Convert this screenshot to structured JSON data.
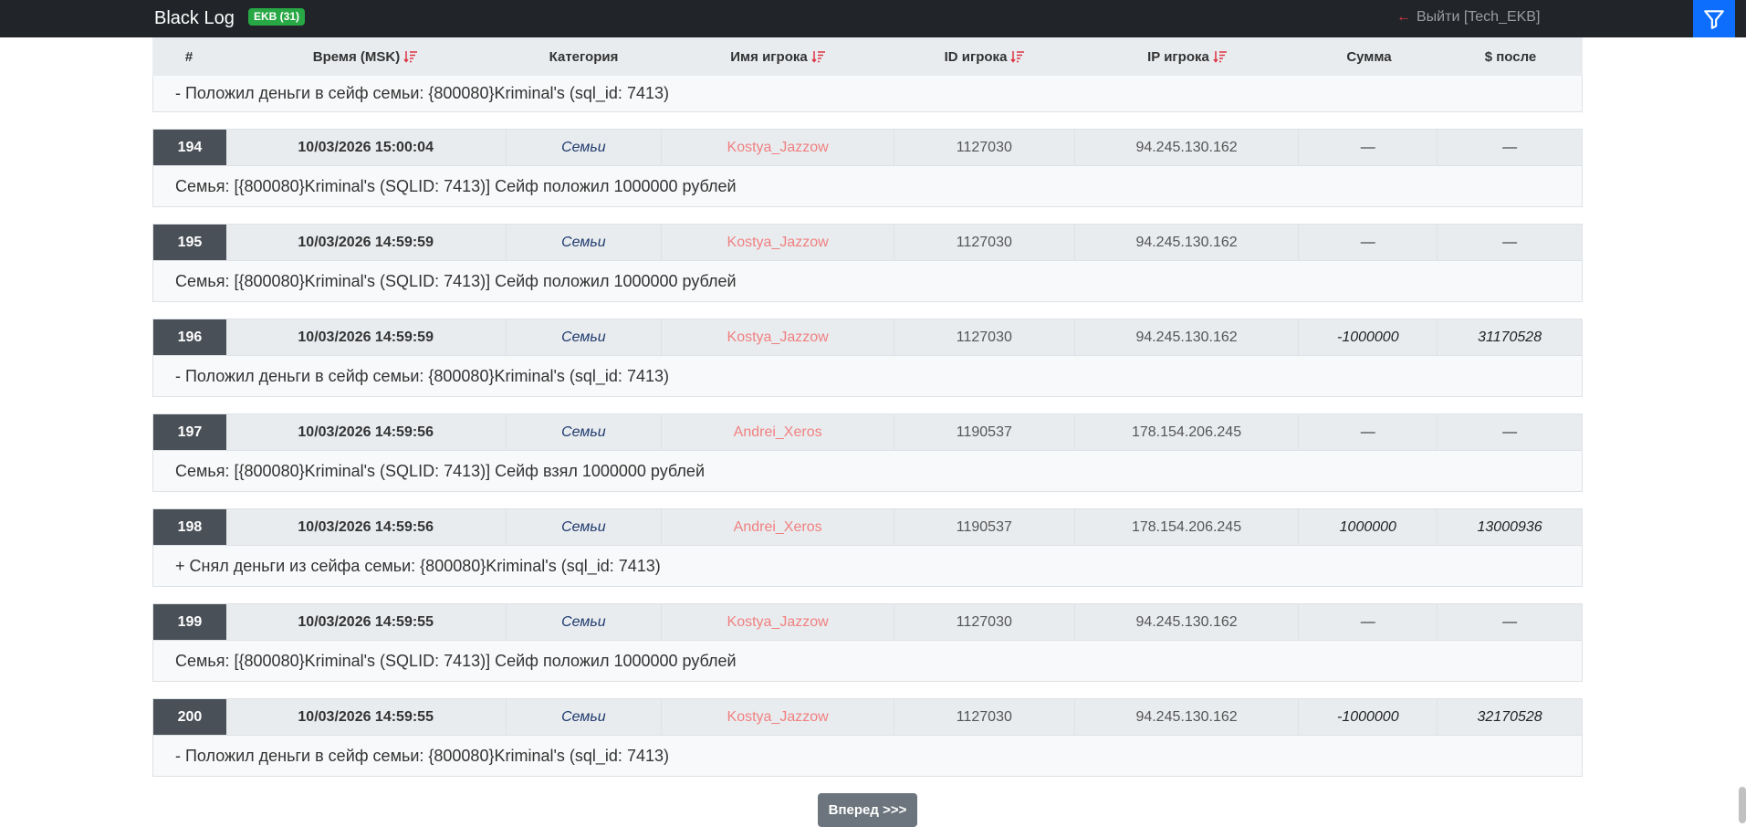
{
  "navbar": {
    "brand": "Black Log",
    "badge": "EKB (31)",
    "logout_arrow": "←",
    "logout_label": "Выйти [Tech_EKB]",
    "filter_icon": "funnel-icon",
    "accent": "#0d6efd"
  },
  "table": {
    "headers": [
      "#",
      "Время (MSK)",
      "Категория",
      "Имя игрока",
      "ID игрока",
      "IP игрока",
      "Сумма",
      "$ после"
    ],
    "first_message": "- Положил деньги в сейф семьи: {800080}Kriminal's (sql_id: 7413)",
    "entries": [
      {
        "num": "194",
        "time": "10/03/2026 15:00:04",
        "category": "Семьи",
        "player": "Kostya_Jazzow",
        "player_id": "1127030",
        "ip": "94.245.130.162",
        "amount": "—",
        "after": "—",
        "message": "Семья: [{800080}Kriminal's (SQLID: 7413)] Сейф положил 1000000 рублей"
      },
      {
        "num": "195",
        "time": "10/03/2026 14:59:59",
        "category": "Семьи",
        "player": "Kostya_Jazzow",
        "player_id": "1127030",
        "ip": "94.245.130.162",
        "amount": "—",
        "after": "—",
        "message": "Семья: [{800080}Kriminal's (SQLID: 7413)] Сейф положил 1000000 рублей"
      },
      {
        "num": "196",
        "time": "10/03/2026 14:59:59",
        "category": "Семьи",
        "player": "Kostya_Jazzow",
        "player_id": "1127030",
        "ip": "94.245.130.162",
        "amount": "-1000000",
        "after": "31170528",
        "message": "- Положил деньги в сейф семьи: {800080}Kriminal's (sql_id: 7413)"
      },
      {
        "num": "197",
        "time": "10/03/2026 14:59:56",
        "category": "Семьи",
        "player": "Andrei_Xeros",
        "player_id": "1190537",
        "ip": "178.154.206.245",
        "amount": "—",
        "after": "—",
        "message": "Семья: [{800080}Kriminal's (SQLID: 7413)] Сейф взял 1000000 рублей"
      },
      {
        "num": "198",
        "time": "10/03/2026 14:59:56",
        "category": "Семьи",
        "player": "Andrei_Xeros",
        "player_id": "1190537",
        "ip": "178.154.206.245",
        "amount": "1000000",
        "after": "13000936",
        "message": "+ Снял деньги из сейфа семьи: {800080}Kriminal's (sql_id: 7413)"
      },
      {
        "num": "199",
        "time": "10/03/2026 14:59:55",
        "category": "Семьи",
        "player": "Kostya_Jazzow",
        "player_id": "1127030",
        "ip": "94.245.130.162",
        "amount": "—",
        "after": "—",
        "message": "Семья: [{800080}Kriminal's (SQLID: 7413)] Сейф положил 1000000 рублей"
      },
      {
        "num": "200",
        "time": "10/03/2026 14:59:55",
        "category": "Семьи",
        "player": "Kostya_Jazzow",
        "player_id": "1127030",
        "ip": "94.245.130.162",
        "amount": "-1000000",
        "after": "32170528",
        "message": "- Положил деньги в сейф семьи: {800080}Kriminal's (sql_id: 7413)"
      }
    ]
  },
  "pagination": {
    "next_label": "Вперед >>>"
  },
  "colors": {
    "player_name": "#f08080",
    "row_number_bg": "#495057",
    "category": "#1e3a6e",
    "sort_icon": "#dc3545"
  }
}
